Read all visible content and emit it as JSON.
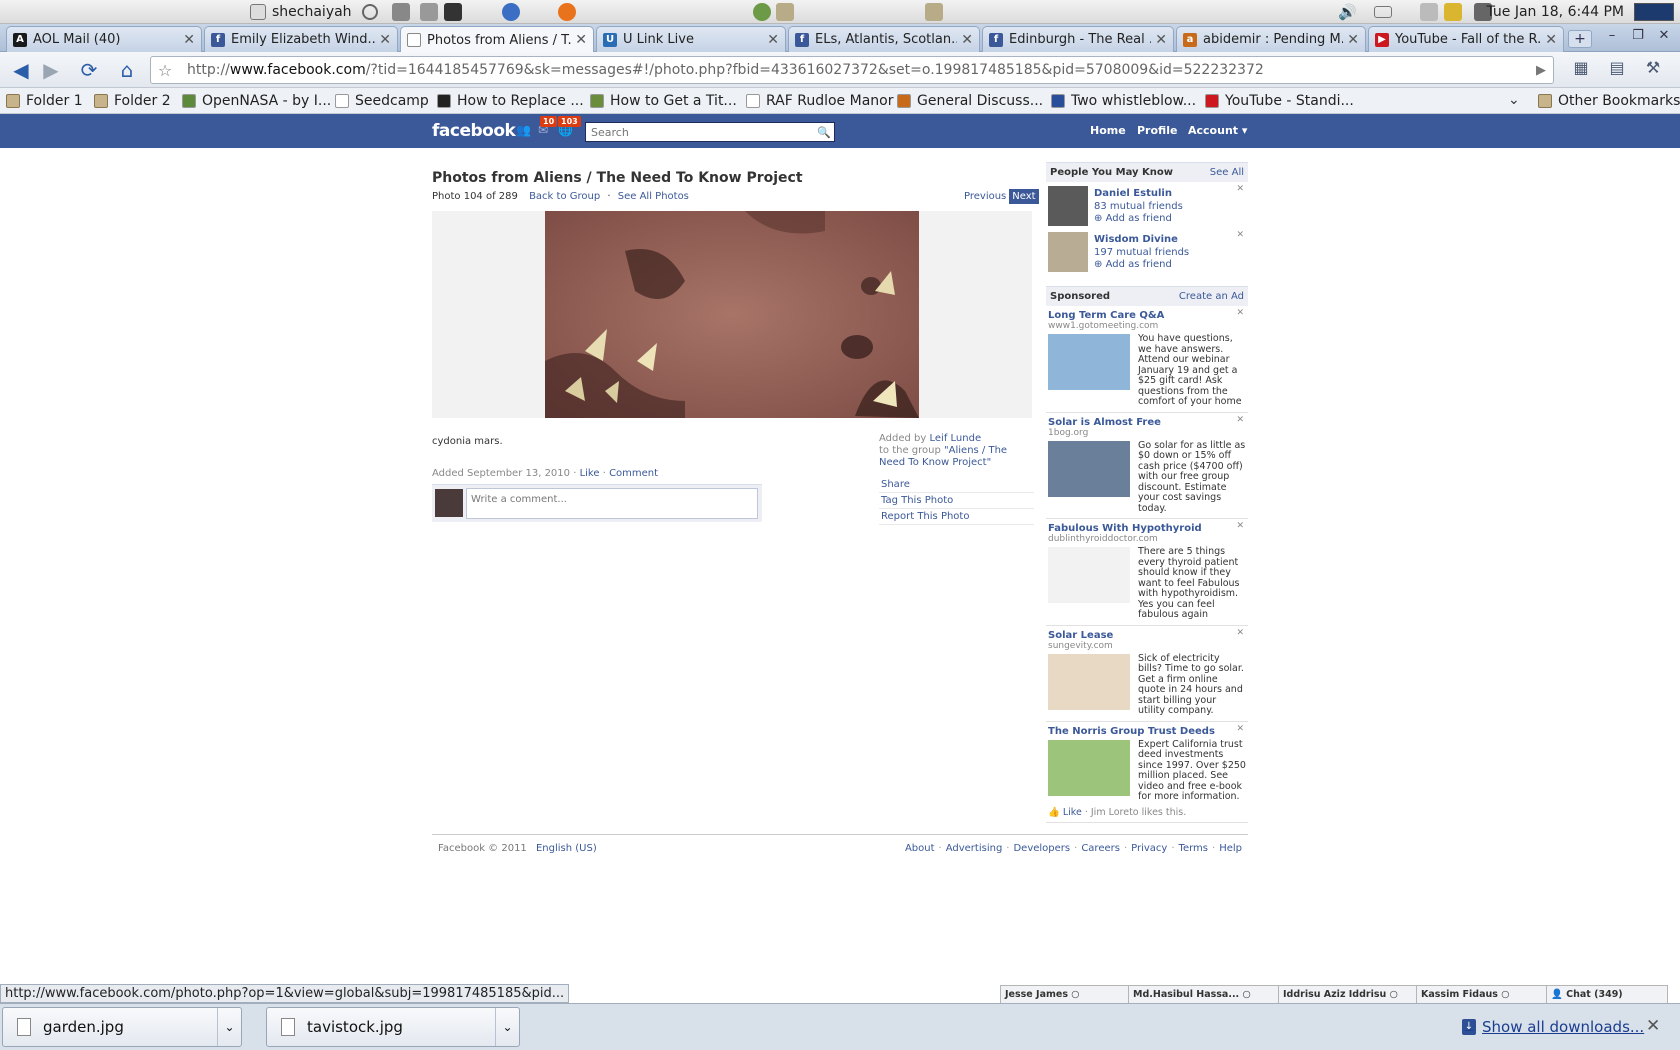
{
  "os_panel": {
    "user": "shechaiyah",
    "clock": "Tue Jan 18,  6:44 PM"
  },
  "tabs": [
    {
      "label": "AOL Mail (40)",
      "icon": "aol-icon",
      "color": "#1a1a1a",
      "glyph": "A"
    },
    {
      "label": "Emily Elizabeth Wind...",
      "icon": "facebook-icon",
      "color": "#3b5998",
      "glyph": "f"
    },
    {
      "label": "Photos from Aliens / T...",
      "icon": "page-icon",
      "color": "#ffffff",
      "glyph": ""
    },
    {
      "label": "U Link Live",
      "icon": "ulink-icon",
      "color": "#2a6db5",
      "glyph": "U"
    },
    {
      "label": "ELs, Atlantis, Scotlan...",
      "icon": "facebook-icon",
      "color": "#3b5998",
      "glyph": "f"
    },
    {
      "label": "Edinburgh - The Real ...",
      "icon": "facebook-icon",
      "color": "#3b5998",
      "glyph": "f"
    },
    {
      "label": "abidemir : Pending M...",
      "icon": "user-icon",
      "color": "#c76b1a",
      "glyph": "a"
    },
    {
      "label": "YouTube - Fall of the R...",
      "icon": "youtube-icon",
      "color": "#cc181e",
      "glyph": "▶"
    }
  ],
  "toolbar": {
    "url_prefix": "http://",
    "url_host": "www.facebook.com",
    "url_rest": "/?tid=1644185457769&sk=messages#!/photo.php?fbid=433616027372&set=o.199817485185&pid=5708009&id=522232372"
  },
  "bookmarks": [
    {
      "label": "Folder 1",
      "icon": "folder-icon"
    },
    {
      "label": "Folder 2",
      "icon": "folder-icon"
    },
    {
      "label": "OpenNASA - by I...",
      "icon": "opennasa-icon"
    },
    {
      "label": "Seedcamp",
      "icon": "page-icon"
    },
    {
      "label": "How to Replace ...",
      "icon": "howto-icon"
    },
    {
      "label": "How to Get a Tit...",
      "icon": "wikihow-icon"
    },
    {
      "label": "RAF Rudloe Manor",
      "icon": "page-icon"
    },
    {
      "label": "General Discuss...",
      "icon": "forum-icon"
    },
    {
      "label": "Two whistleblow...",
      "icon": "news-icon"
    },
    {
      "label": "YouTube - Standi...",
      "icon": "youtube-icon"
    }
  ],
  "other_bookmarks": "Other Bookmarks",
  "facebook": {
    "logo": "facebook",
    "badges": {
      "messages": "10",
      "notifications": "103"
    },
    "search_placeholder": "Search",
    "nav": {
      "home": "Home",
      "profile": "Profile",
      "account": "Account ▾"
    }
  },
  "photo": {
    "title": "Photos from Aliens / The Need To Know Project",
    "counter": "Photo 104 of 289",
    "back_to_group": "Back to Group",
    "see_all": "See All Photos",
    "previous": "Previous",
    "next": "Next",
    "caption": "cydonia mars.",
    "added_date": "Added September 13, 2010",
    "like": "Like",
    "comment": "Comment",
    "comment_placeholder": "Write a comment...",
    "added_by_prefix": "Added by",
    "added_by_name": "Leif Lunde",
    "group_prefix": "to the group",
    "group_name": "\"Aliens / The Need To Know Project\"",
    "actions": [
      "Share",
      "Tag This Photo",
      "Report This Photo"
    ]
  },
  "people_you_may_know": {
    "header": "People You May Know",
    "see_all": "See All",
    "people": [
      {
        "name": "Daniel Estulin",
        "mutual": "83 mutual friends",
        "add": "Add as friend"
      },
      {
        "name": "Wisdom Divine",
        "mutual": "197 mutual friends",
        "add": "Add as friend"
      }
    ]
  },
  "sponsored": {
    "header": "Sponsored",
    "create_ad": "Create an Ad",
    "ads": [
      {
        "title": "Long Term Care Q&A",
        "domain": "www1.gotomeeting.com",
        "text": "You have questions, we have answers. Attend our webinar January 19 and get a $25 gift card! Ask questions from the comfort of your home",
        "img": "#8fb6d8",
        "like": ""
      },
      {
        "title": "Solar is Almost Free",
        "domain": "1bog.org",
        "text": "Go solar for as little as $0 down or 15% off cash price ($4700 off) with our free group discount. Estimate your cost savings today.",
        "img": "#6a7f9a",
        "like": ""
      },
      {
        "title": "Fabulous With Hypothyroid",
        "domain": "dublinthyroiddoctor.com",
        "text": "There are 5 things every thyroid patient should know if they want to feel Fabulous with hypothyroidism. Yes you can feel fabulous again",
        "img": "#f2f2f2",
        "like": ""
      },
      {
        "title": "Solar Lease",
        "domain": "sungevity.com",
        "text": "Sick of electricity bills? Time to go solar. Get a firm online quote in 24 hours and start billing your utility company.",
        "img": "#e7d9c4",
        "like": ""
      },
      {
        "title": "The Norris Group Trust Deeds",
        "domain": "",
        "text": "Expert California trust deed investments since 1997. Over $250 million placed. See video and free e-book for more information.",
        "img": "#9cc47a",
        "like_link": "Like",
        "like": "· Jim Loreto likes this."
      }
    ]
  },
  "footer": {
    "copyright": "Facebook © 2011",
    "language": "English (US)",
    "links": [
      "About",
      "Advertising",
      "Developers",
      "Careers",
      "Privacy",
      "Terms",
      "Help"
    ]
  },
  "status_url": "http://www.facebook.com/photo.php?op=1&view=global&subj=199817485185&pid...",
  "chat": {
    "contacts": [
      "Jesse James ○",
      "Md.Hasibul Hassa... ○",
      "Iddrisu Aziz Iddrisu ○",
      "Kassim Fidaus ○"
    ],
    "chat_label": "Chat (349)"
  },
  "downloads": {
    "items": [
      "garden.jpg",
      "tavistock.jpg"
    ],
    "show_all": "Show all downloads..."
  }
}
